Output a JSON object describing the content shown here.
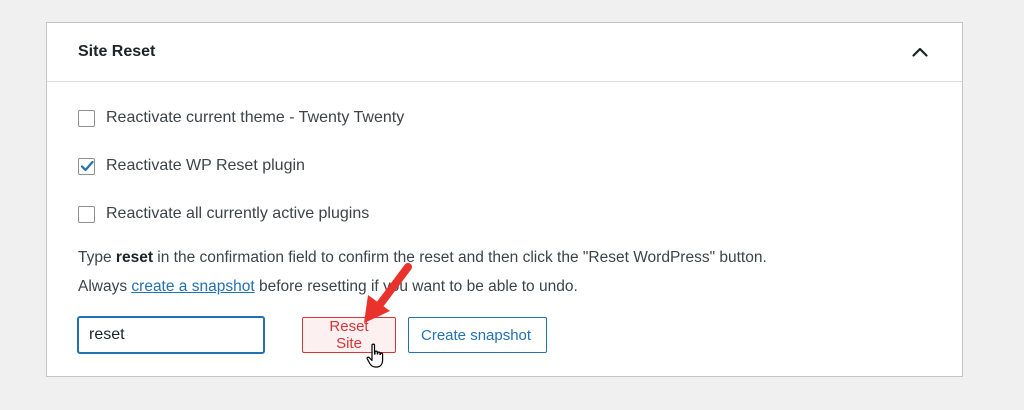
{
  "panel": {
    "title": "Site Reset",
    "collapse_icon": "chevron-up-icon"
  },
  "options": [
    {
      "label": "Reactivate current theme - Twenty Twenty",
      "checked": false
    },
    {
      "label": "Reactivate WP Reset plugin",
      "checked": true
    },
    {
      "label": "Reactivate all currently active plugins",
      "checked": false
    }
  ],
  "help": {
    "line1_prefix": "Type ",
    "line1_keyword": "reset",
    "line1_suffix": " in the confirmation field to confirm the reset and then click the \"Reset WordPress\" button.",
    "line2_prefix": "Always ",
    "line2_link": "create a snapshot",
    "line2_suffix": " before resetting if you want to be able to undo."
  },
  "confirm_field": {
    "value": "reset"
  },
  "buttons": {
    "reset_label": "Reset Site",
    "snapshot_label": "Create snapshot"
  },
  "colors": {
    "accent": "#2271b1",
    "danger": "#d63638",
    "annotation_arrow": "#e8322b",
    "checkmark": "#2271b1"
  },
  "annotation": {
    "arrow_icon": "red-arrow-icon",
    "cursor_icon": "hand-pointer-icon"
  }
}
